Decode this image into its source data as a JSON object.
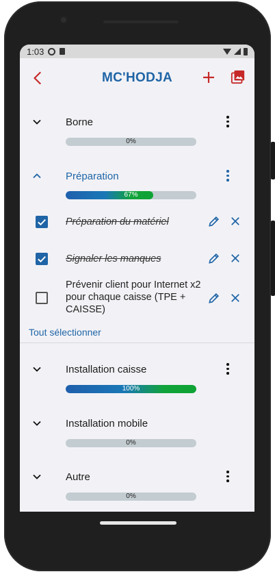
{
  "status": {
    "time": "1:03"
  },
  "appbar": {
    "title": "MC'HODJA"
  },
  "icons": {
    "back": "back-arrow-icon",
    "add": "plus-icon",
    "gallery": "photo-library-icon",
    "more": "more-vert-icon",
    "edit": "pencil-icon",
    "delete": "close-icon"
  },
  "colors": {
    "brand_blue": "#1f64a6",
    "accent_red": "#c62828",
    "progress_green": "#11a33b",
    "progress_track": "#c3ccd1"
  },
  "sections": [
    {
      "title": "Borne",
      "progress": 0,
      "progress_label": "0%",
      "expanded": false
    },
    {
      "title": "Préparation",
      "progress": 67,
      "progress_label": "67%",
      "expanded": true,
      "tasks": [
        {
          "text": "Préparation du matériel",
          "checked": true
        },
        {
          "text": "Signaler les manques",
          "checked": true
        },
        {
          "text": "Prévenir client pour Internet x2 pour chaque caisse (TPE + CAISSE)",
          "checked": false
        }
      ],
      "select_all": "Tout sélectionner"
    },
    {
      "title": "Installation caisse",
      "progress": 100,
      "progress_label": "100%",
      "expanded": false
    },
    {
      "title": "Installation mobile",
      "progress": 0,
      "progress_label": "0%",
      "expanded": false
    },
    {
      "title": "Autre",
      "progress": 0,
      "progress_label": "0%",
      "expanded": false
    }
  ]
}
